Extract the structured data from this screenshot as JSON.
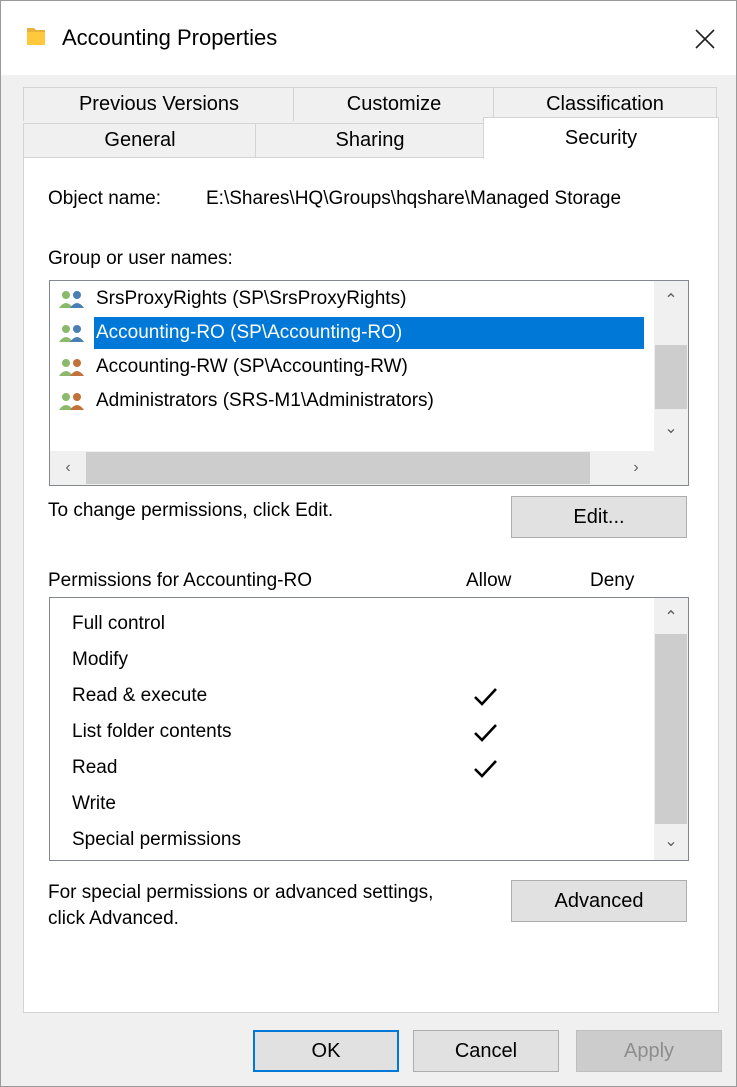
{
  "window": {
    "title": "Accounting Properties",
    "icon": "folder-icon",
    "accent_color": "#0078d7"
  },
  "tabs": {
    "back_row": [
      "Previous Versions",
      "Customize",
      "Classification"
    ],
    "front_row": [
      "General",
      "Sharing",
      "Security"
    ],
    "selected": "Security"
  },
  "security": {
    "object_name_label": "Object name:",
    "object_name_value": "E:\\Shares\\HQ\\Groups\\hqshare\\Managed Storage",
    "group_label": "Group or user names:",
    "users": [
      {
        "label": "SrsProxyRights (SP\\SrsProxyRights)",
        "icon": "users-icon",
        "selected": false
      },
      {
        "label": "Accounting-RO (SP\\Accounting-RO)",
        "icon": "users-icon",
        "selected": true
      },
      {
        "label": "Accounting-RW (SP\\Accounting-RW)",
        "icon": "users-icon",
        "selected": false
      },
      {
        "label": "Administrators (SRS-M1\\Administrators)",
        "icon": "users-icon",
        "selected": false
      }
    ],
    "change_hint": "To change permissions, click Edit.",
    "edit_button": "Edit...",
    "permissions_label": "Permissions for Accounting-RO",
    "allow_header": "Allow",
    "deny_header": "Deny",
    "permissions": [
      {
        "name": "Full control",
        "allow": false,
        "deny": false
      },
      {
        "name": "Modify",
        "allow": false,
        "deny": false
      },
      {
        "name": "Read & execute",
        "allow": true,
        "deny": false
      },
      {
        "name": "List folder contents",
        "allow": true,
        "deny": false
      },
      {
        "name": "Read",
        "allow": true,
        "deny": false
      },
      {
        "name": "Write",
        "allow": false,
        "deny": false
      },
      {
        "name": "Special permissions",
        "allow": false,
        "deny": false
      }
    ],
    "advanced_hint_line1": "For special permissions or advanced settings,",
    "advanced_hint_line2": "click Advanced.",
    "advanced_button": "Advanced"
  },
  "footer": {
    "ok": "OK",
    "cancel": "Cancel",
    "apply": "Apply",
    "apply_enabled": false
  }
}
